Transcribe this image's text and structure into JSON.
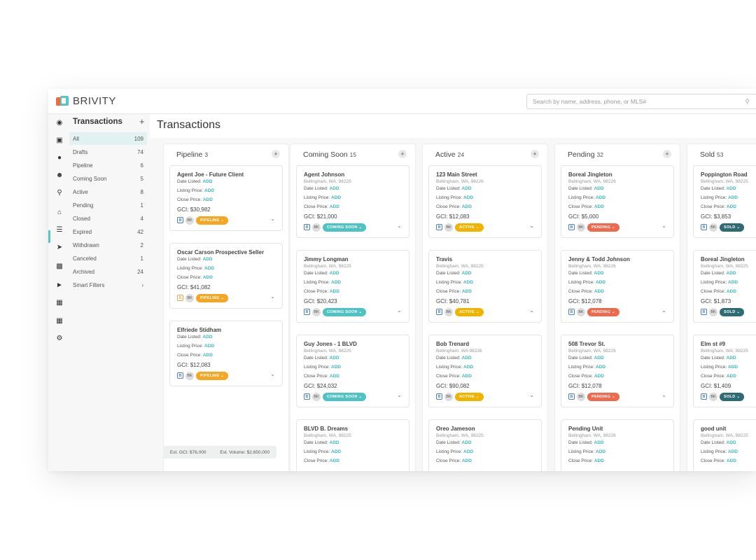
{
  "brand": {
    "name": "BRIVITY"
  },
  "search": {
    "placeholder": "Search by name, address, phone, or MLS#"
  },
  "sidebar": {
    "title": "Transactions",
    "items": [
      {
        "label": "All",
        "count": "109"
      },
      {
        "label": "Drafts",
        "count": "74"
      },
      {
        "label": "Pipeline",
        "count": "6"
      },
      {
        "label": "Coming Soon",
        "count": "5"
      },
      {
        "label": "Active",
        "count": "8"
      },
      {
        "label": "Pending",
        "count": "1"
      },
      {
        "label": "Closed",
        "count": "4"
      },
      {
        "label": "Expired",
        "count": "42"
      },
      {
        "label": "Withdrawn",
        "count": "2"
      },
      {
        "label": "Canceled",
        "count": "1"
      },
      {
        "label": "Archived",
        "count": "24"
      },
      {
        "label": "Smart Filters",
        "count": "›"
      }
    ]
  },
  "main": {
    "title": "Transactions"
  },
  "labels": {
    "date_listed": "Date Listed:",
    "listing_price": "Listing Price:",
    "close_price": "Close Price:",
    "add": "ADD",
    "gci": "GCI:",
    "b": "B",
    "s": "S",
    "bk": "BK"
  },
  "columns": [
    {
      "title": "Pipeline",
      "count": "3",
      "cards": [
        {
          "title": "Agent Joe - Future Client",
          "address": "",
          "gci": "$30,982",
          "tag": "B",
          "status": "PIPELINE"
        },
        {
          "title": "Oscar Carson Prospective Seller",
          "address": "",
          "gci": "$41,082",
          "tag": "S",
          "status": "PIPELINE"
        },
        {
          "title": "Elfriede Stidham",
          "address": "",
          "gci": "$12,083",
          "tag": "B",
          "status": "PIPELINE"
        }
      ]
    },
    {
      "title": "Coming Soon",
      "count": "15",
      "cards": [
        {
          "title": "Agent Johnson",
          "address": "Bellingham, WA, 98225",
          "gci": "$21,000",
          "tag": "B",
          "status": "COMING SOON"
        },
        {
          "title": "Jimmy Longman",
          "address": "Bellingham, WA, 98225",
          "gci": "$20,423",
          "tag": "B",
          "status": "COMING SOON"
        },
        {
          "title": "Guy Jones - 1 BLVD",
          "address": "Bellingham, WA, 98225",
          "gci": "$24,032",
          "tag": "B",
          "status": "COMING SOON"
        },
        {
          "title": "BLVD B. Dreams",
          "address": "Bellingham, WA, 98225",
          "gci": "",
          "tag": "",
          "status": ""
        }
      ]
    },
    {
      "title": "Active",
      "count": "24",
      "cards": [
        {
          "title": "123 Main Street",
          "address": "Bellingham, WA, 98226",
          "gci": "$12,083",
          "tag": "B",
          "status": "ACTIVE"
        },
        {
          "title": "Travis",
          "address": "Bellingham, WA, 98225",
          "gci": "$40,781",
          "tag": "B",
          "status": "ACTIVE"
        },
        {
          "title": "Bob Trenard",
          "address": "Bellingham, WA 98226",
          "gci": "$90,082",
          "tag": "B",
          "status": "ACTIVE"
        },
        {
          "title": "Oreo Jameson",
          "address": "Bellingham, WA, 98225",
          "gci": "",
          "tag": "",
          "status": ""
        }
      ]
    },
    {
      "title": "Pending",
      "count": "32",
      "cards": [
        {
          "title": "Boreal Jingleton",
          "address": "Bellingham, WA, 98226",
          "gci": "$5,000",
          "tag": "B",
          "status": "PENDING"
        },
        {
          "title": "Jenny & Todd Johnson",
          "address": "Bellingham, WA, 98226",
          "gci": "$12,078",
          "tag": "B",
          "status": "PENDING"
        },
        {
          "title": "508 Trevor St.",
          "address": "Bellingham, WA, 98225",
          "gci": "$12,078",
          "tag": "B",
          "status": "PENDING"
        },
        {
          "title": "Pending Unit",
          "address": "Bellingham, WA, 98226",
          "gci": "",
          "tag": "",
          "status": ""
        }
      ]
    },
    {
      "title": "Sold",
      "count": "53",
      "cards": [
        {
          "title": "Poppington Road",
          "address": "Bellingham, WA, 98225",
          "gci": "$3,853",
          "tag": "B",
          "status": "SOLD"
        },
        {
          "title": "Boreal Jingleton",
          "address": "Bellingham, WA, 98225",
          "gci": "$1,873",
          "tag": "B",
          "status": "SOLD"
        },
        {
          "title": "Elm st #9",
          "address": "Bellingham, WA, 98225",
          "gci": "$1,409",
          "tag": "B",
          "status": "SOLD"
        },
        {
          "title": "good unit",
          "address": "Bellingham, WA, 98225",
          "gci": "",
          "tag": "",
          "status": ""
        }
      ]
    }
  ],
  "footer": {
    "est_gci": "Est. GCI: $76,000",
    "est_volume": "Est. Volume: $2,650,000"
  },
  "colors": {
    "accent": "#59c4c5",
    "pipeline": "#f5a623",
    "coming_soon": "#4fc3c4",
    "active": "#f0b400",
    "pending": "#ee6a4e",
    "sold": "#2f6b73"
  }
}
